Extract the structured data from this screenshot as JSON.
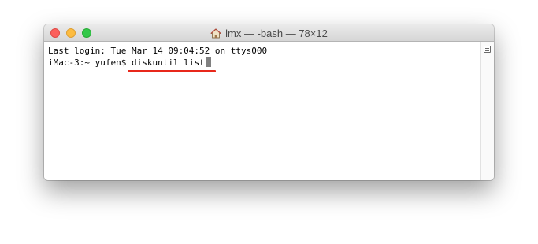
{
  "window": {
    "title": "lmx — -bash — 78×12",
    "title_icon": "home-icon"
  },
  "terminal": {
    "last_login": "Last login: Tue Mar 14 09:04:52 on ttys000",
    "prompt": "iMac-3:~ yufen$ ",
    "command": "diskuntil list"
  },
  "colors": {
    "close": "#fc605c",
    "minimize": "#fdbc40",
    "maximize": "#34c84a",
    "highlight_underline": "#e8281b",
    "cursor": "#808080"
  }
}
